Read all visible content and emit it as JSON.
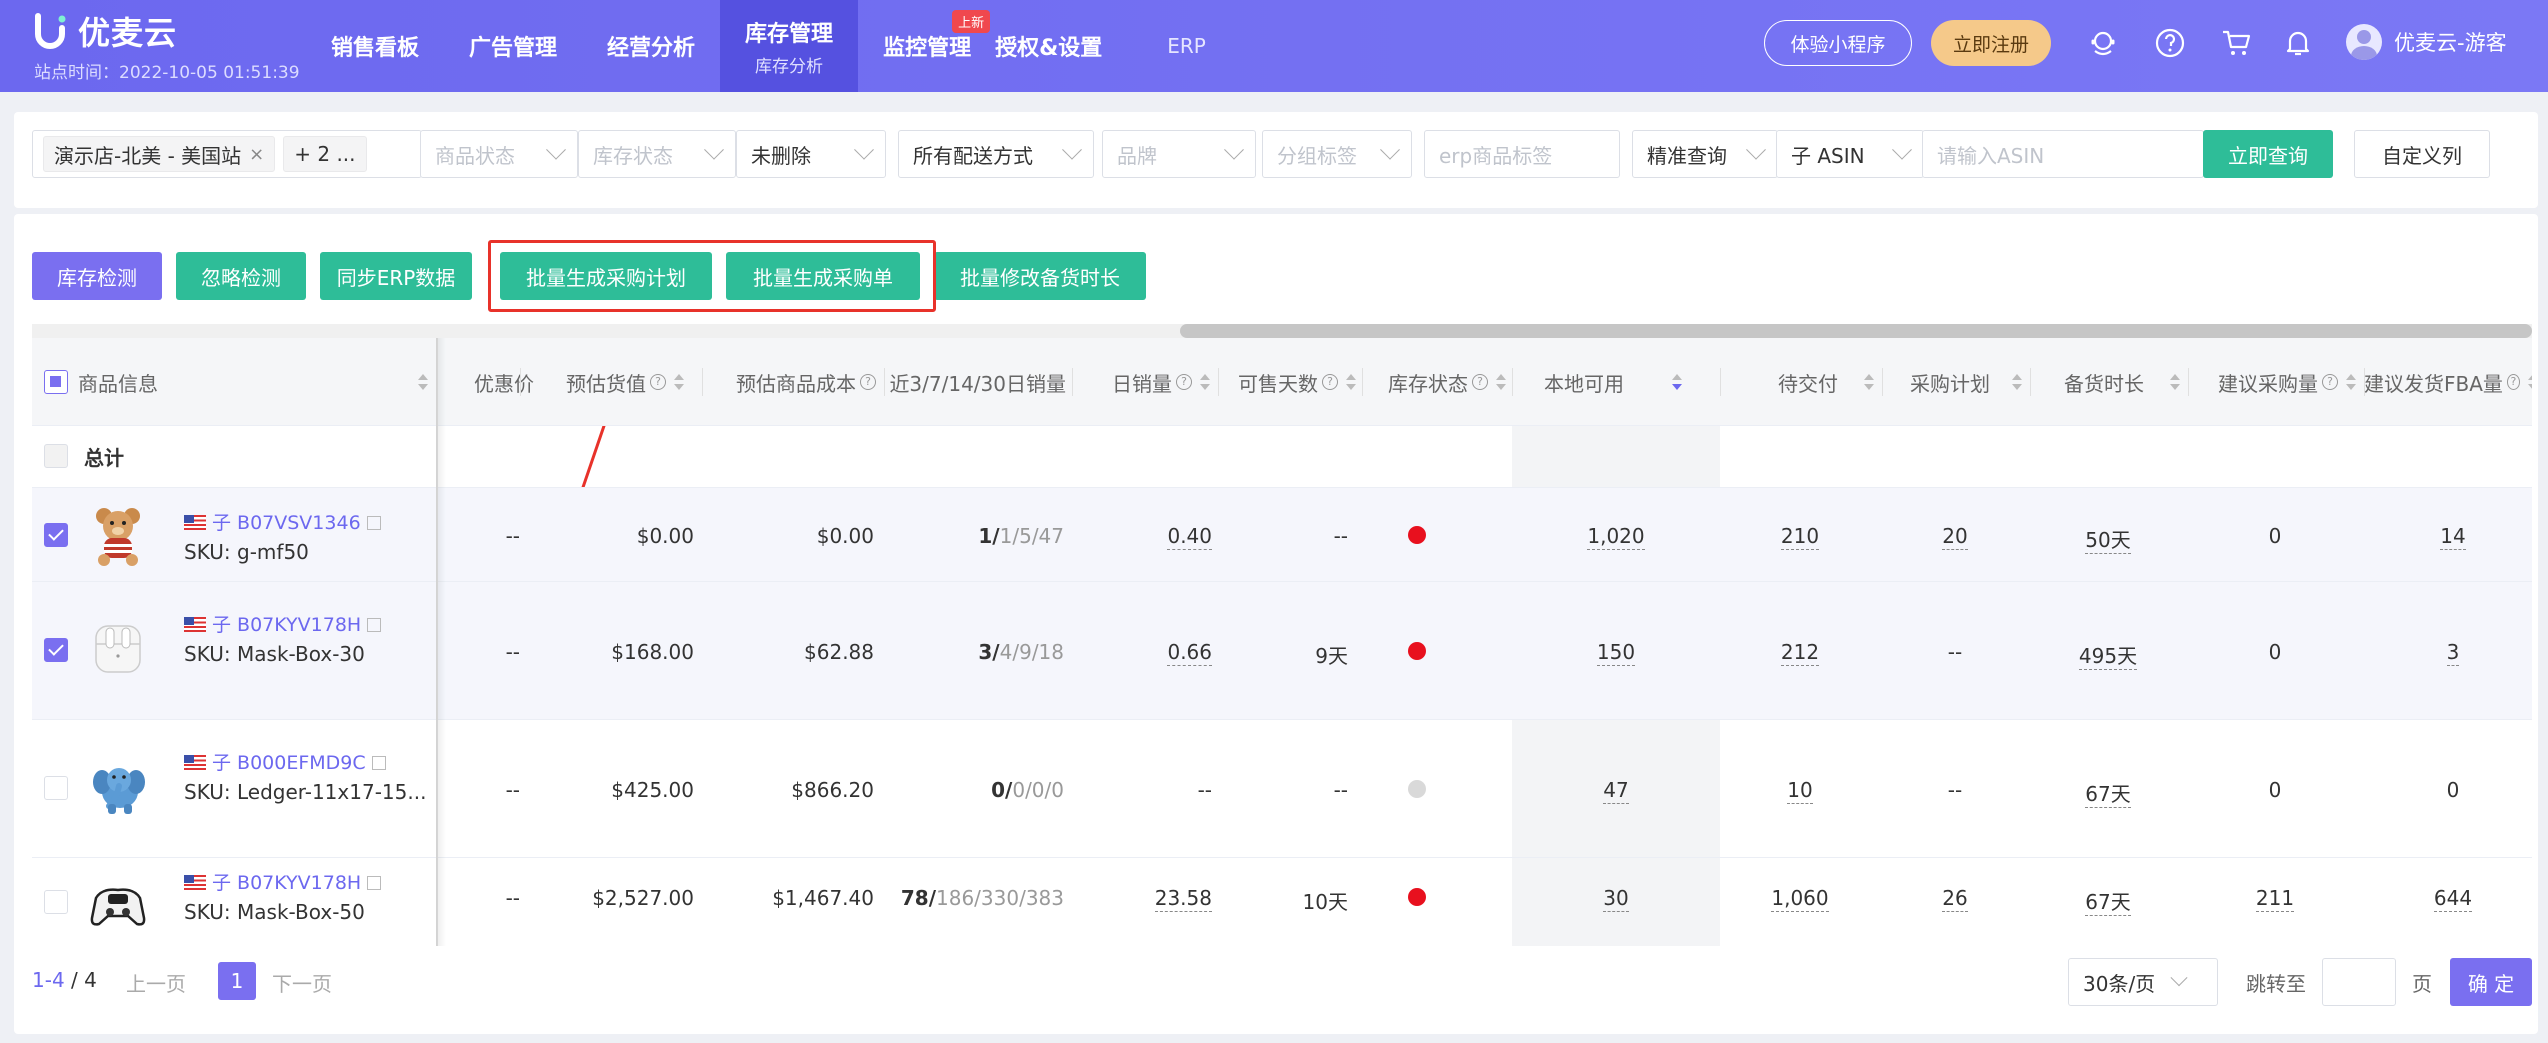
{
  "brand": {
    "name": "优麦云",
    "site_time": "站点时间：2022-10-05 01:51:39"
  },
  "nav": [
    {
      "label": "销售看板"
    },
    {
      "label": "广告管理"
    },
    {
      "label": "经营分析"
    },
    {
      "label": "库存管理",
      "sub": "库存分析",
      "active": true
    },
    {
      "label": "监控管理",
      "badge": "上新"
    },
    {
      "label": "授权&设置"
    },
    {
      "label": "ERP"
    }
  ],
  "header": {
    "mini_program": "体验小程序",
    "register": "立即注册",
    "user": "优麦云-游客"
  },
  "filters": {
    "store_tag": "演示店-北美 - 美国站",
    "more_tag": "+ 2 ...",
    "product_status": "商品状态",
    "stock_status": "库存状态",
    "deleted": "未删除",
    "shipping": "所有配送方式",
    "brand": "品牌",
    "group_tag": "分组标签",
    "erp_tag": "erp商品标签",
    "match_mode": "精准查询",
    "asin_type": "子 ASIN",
    "asin_placeholder": "请输入ASIN",
    "query_btn": "立即查询",
    "custom_cols_btn": "自定义列"
  },
  "actions": {
    "inventory_check": "库存检测",
    "ignore_check": "忽略检测",
    "sync_erp": "同步ERP数据",
    "batch_plan": "批量生成采购计划",
    "batch_order": "批量生成采购单",
    "batch_modify": "批量修改备货时长"
  },
  "table": {
    "headers": {
      "product": "商品信息",
      "discount": "优惠价",
      "est_value": "预估货值",
      "est_cost": "预估商品成本",
      "sales_7_14_30": "近3/7/14/30日销量",
      "daily_sales": "日销量",
      "days_sellable": "可售天数",
      "stock_status": "库存状态",
      "local_avail": "本地可用",
      "pending": "待交付",
      "purchase_plan": "采购计划",
      "lead_time": "备货时长",
      "suggest_purchase": "建议采购量",
      "suggest_fba": "建议发货FBA量"
    },
    "total_label": "总计",
    "rows": [
      {
        "asin": "子 B07VSV1346",
        "sku": "SKU: g-mf50",
        "discount": "--",
        "est_value": "$0.00",
        "est_cost": "$0.00",
        "sales_main": "1/",
        "sales_rest": "1/5/47",
        "daily": "0.40",
        "days": "--",
        "status_color": "#e8101e",
        "local": "1,020",
        "pending": "210",
        "plan": "20",
        "lead": "50天",
        "suggest": "0",
        "fba": "14",
        "checked": true
      },
      {
        "asin": "子 B07KYV178H",
        "sku": "SKU: Mask-Box-30",
        "discount": "--",
        "est_value": "$168.00",
        "est_cost": "$62.88",
        "sales_main": "3/",
        "sales_rest": "4/9/18",
        "daily": "0.66",
        "days": "9天",
        "status_color": "#e8101e",
        "local": "150",
        "pending": "212",
        "plan": "--",
        "lead": "495天",
        "suggest": "0",
        "fba": "3",
        "checked": true
      },
      {
        "asin": "子 B000EFMD9C",
        "sku": "SKU: Ledger-11x17-15...",
        "discount": "--",
        "est_value": "$425.00",
        "est_cost": "$866.20",
        "sales_main": "0/",
        "sales_rest": "0/0/0",
        "daily": "--",
        "days": "--",
        "status_color": "#d9d9d9",
        "local": "47",
        "pending": "10",
        "plan": "--",
        "lead": "67天",
        "suggest": "0",
        "fba": "0",
        "checked": false
      },
      {
        "asin": "子 B07KYV178H",
        "sku": "SKU: Mask-Box-50",
        "discount": "--",
        "est_value": "$2,527.00",
        "est_cost": "$1,467.40",
        "sales_main": "78/",
        "sales_rest": "186/330/383",
        "daily": "23.58",
        "days": "10天",
        "status_color": "#e8101e",
        "local": "30",
        "pending": "1,060",
        "plan": "26",
        "lead": "67天",
        "suggest": "211",
        "fba": "644",
        "checked": false
      }
    ]
  },
  "pager": {
    "range": "1-4",
    "total": " / 4",
    "prev": "上一页",
    "page": "1",
    "next": "下一页",
    "size": "30条/页",
    "goto": "跳转至",
    "page_unit": "页",
    "ok": "确 定"
  }
}
